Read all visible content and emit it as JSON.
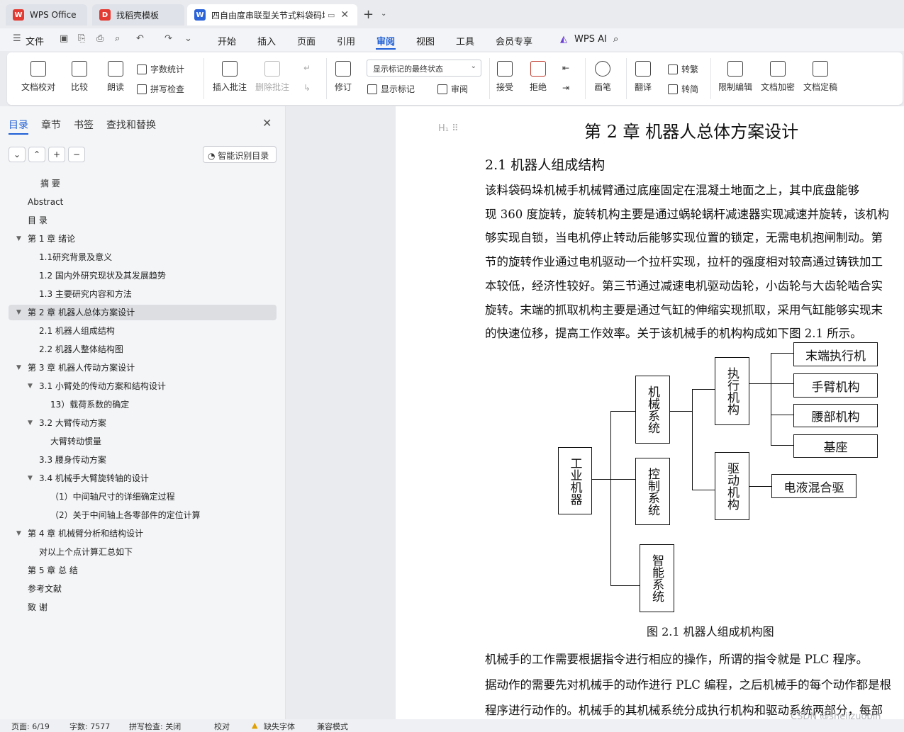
{
  "tabs": [
    {
      "label": "WPS Office",
      "icon": "wps-logo-icon",
      "color": "#e33b33"
    },
    {
      "label": "找稻壳模板",
      "icon": "docer-icon",
      "color": "#e33b33"
    },
    {
      "label": "四自由度串联型关节式料袋码垛机械手设计",
      "icon": "word-doc-icon",
      "color": "#2b63d8"
    }
  ],
  "menu": {
    "file": "文件",
    "items": [
      "开始",
      "插入",
      "页面",
      "引用",
      "审阅",
      "视图",
      "工具",
      "会员专享"
    ],
    "active": "审阅",
    "ai": "WPS AI"
  },
  "ribbon": {
    "proofread": "文档校对",
    "compare": "比较",
    "read_aloud": "朗读",
    "word_count": "字数统计",
    "spell_check": "拼写检查",
    "insert_comment": "插入批注",
    "delete_comment": "删除批注",
    "revise": "修订",
    "show_markup_select": "显示标记的最终状态",
    "show_markup": "显示标记",
    "review": "审阅",
    "accept": "接受",
    "reject": "拒绝",
    "pen": "画笔",
    "translate": "翻译",
    "to_traditional": "转繁",
    "to_simplified": "转简",
    "restrict_edit": "限制编辑",
    "encrypt": "文档加密",
    "finalize": "文档定稿"
  },
  "sidebar": {
    "tabs": [
      "目录",
      "章节",
      "书签",
      "查找和替换"
    ],
    "smart_toc": "智能识别目录",
    "toc": [
      {
        "label": "摘  要",
        "level": 1
      },
      {
        "label": "Abstract",
        "level": 0
      },
      {
        "label": "目  录",
        "level": 0
      },
      {
        "label": "第 1 章    绪论",
        "level": 0
      },
      {
        "label": "1.1研究背景及意义",
        "level": 1
      },
      {
        "label": "1.2  国内外研究现状及其发展趋势",
        "level": 1
      },
      {
        "label": "1.3  主要研究内容和方法",
        "level": 1
      },
      {
        "label": "第 2 章    机器人总体方案设计",
        "level": 0
      },
      {
        "label": "2.1 机器人组成结构",
        "level": 1
      },
      {
        "label": "2.2 机器人整体结构图",
        "level": 1
      },
      {
        "label": "第 3 章  机器人传动方案设计",
        "level": 0
      },
      {
        "label": "3.1 小臂处的传动方案和结构设计",
        "level": 1
      },
      {
        "label": "13）载荷系数的确定",
        "level": 2
      },
      {
        "label": "3.2 大臂传动方案",
        "level": 1
      },
      {
        "label": "大臂转动惯量",
        "level": 2
      },
      {
        "label": "3.3 腰身传动方案",
        "level": 1
      },
      {
        "label": "3.4 机械手大臂旋转轴的设计",
        "level": 1
      },
      {
        "label": "（1）中间轴尺寸的详细确定过程",
        "level": 2
      },
      {
        "label": "（2）关于中间轴上各零部件的定位计算",
        "level": 2
      },
      {
        "label": "第 4 章  机械臂分析和结构设计",
        "level": 0
      },
      {
        "label": "对以上个点计算汇总如下",
        "level": 1
      },
      {
        "label": "第 5 章  总  结",
        "level": 0
      },
      {
        "label": "参考文献",
        "level": 0
      },
      {
        "label": "致  谢",
        "level": 0
      }
    ]
  },
  "document": {
    "chapter_title": "第 2 章    机器人总体方案设计",
    "section_title": "2.1 机器人组成结构",
    "para1": [
      "    该料袋码垛机械手机械臂通过底座固定在混凝土地面之上，其中底盘能够",
      "现 360 度旋转，旋转机构主要是通过蜗轮蜗杆减速器实现减速并旋转，该机构",
      "够实现自锁，当电机停止转动后能够实现位置的锁定，无需电机抱闸制动。第",
      "节的旋转作业通过电机驱动一个拉杆实现，拉杆的强度相对较高通过铸铁加工",
      "本较低，经济性较好。第三节通过减速电机驱动齿轮，小齿轮与大齿轮啮合实",
      "旋转。末端的抓取机构主要是通过气缸的伸缩实现抓取，采用气缸能够实现末",
      "的快速位移，提高工作效率。关于该机械手的机构构成如下图 2.1 所示。"
    ],
    "diagram": {
      "root": "工业机器",
      "mech": "机械系统",
      "control": "控制系统",
      "smart": "智能系统",
      "exec": "执行机构",
      "drive": "驱动机构",
      "end_effector": "末端执行机",
      "forearm": "手臂机构",
      "waist": "腰部机构",
      "base": "基座",
      "hydraulic": "电液混合驱"
    },
    "caption": "图 2.1    机器人组成机构图",
    "para2": [
      "    机械手的工作需要根据指令进行相应的操作，所谓的指令就是 PLC 程序。",
      "据动作的需要先对机械手的动作进行 PLC 编程，之后机械手的每个动作都是根",
      "程序进行动作的。机械手的其机械系统分成执行机构和驱动系统两部分，每部"
    ]
  },
  "status": {
    "page": "页面: 6/19",
    "words": "字数: 7577",
    "spell": "拼写检查: 关闭",
    "proof": "校对",
    "missing_font": "缺失字体",
    "compat": "兼容模式"
  },
  "watermark": "CSDN @shejizuopin"
}
